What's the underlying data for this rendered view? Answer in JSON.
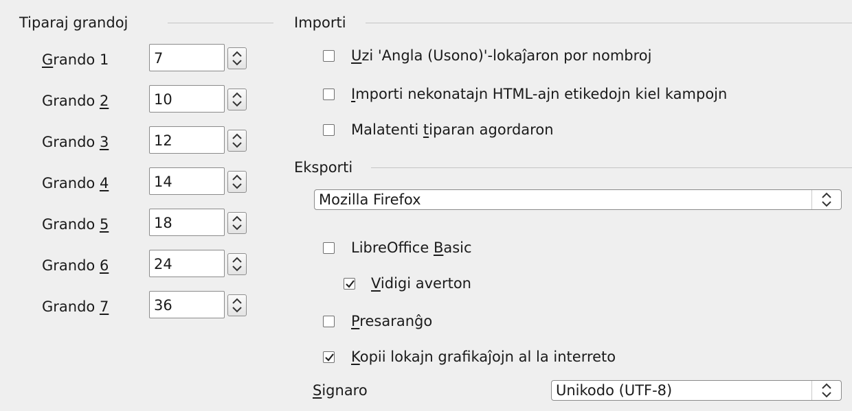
{
  "font_sizes": {
    "title": "Tiparaj grandoj",
    "rows": [
      {
        "label_pre": "",
        "label_ul": "G",
        "label_post": "rando 1",
        "value": "7"
      },
      {
        "label_pre": "Grando ",
        "label_ul": "2",
        "label_post": "",
        "value": "10"
      },
      {
        "label_pre": "Grando ",
        "label_ul": "3",
        "label_post": "",
        "value": "12"
      },
      {
        "label_pre": "Grando ",
        "label_ul": "4",
        "label_post": "",
        "value": "14"
      },
      {
        "label_pre": "Grando ",
        "label_ul": "5",
        "label_post": "",
        "value": "18"
      },
      {
        "label_pre": "Grando ",
        "label_ul": "6",
        "label_post": "",
        "value": "24"
      },
      {
        "label_pre": "Grando ",
        "label_ul": "7",
        "label_post": "",
        "value": "36"
      }
    ]
  },
  "import": {
    "title": "Importi",
    "options": [
      {
        "pre": "",
        "ul": "U",
        "post": "zi 'Angla (Usono)'-lokaĵaron por nombroj",
        "checked": false
      },
      {
        "pre": "",
        "ul": "I",
        "post": "mporti nekonatajn HTML-ajn etikedojn kiel kampojn",
        "checked": false
      },
      {
        "pre": "Malatenti ",
        "ul": "t",
        "post": "iparan agordaron",
        "checked": false
      }
    ]
  },
  "export": {
    "title": "Eksporti",
    "browser_selected": "Mozilla Firefox",
    "basic": {
      "pre": "LibreOffice ",
      "ul": "B",
      "post": "asic",
      "checked": false
    },
    "warning": {
      "pre": "",
      "ul": "V",
      "post": "idigi averton",
      "checked": true
    },
    "print_layout": {
      "pre": "",
      "ul": "P",
      "post": "resaranĝo",
      "checked": false
    },
    "copy_graphics": {
      "pre": "",
      "ul": "K",
      "post": "opii lokajn grafikaĵojn al la interreto",
      "checked": true
    },
    "charset_label": {
      "pre": "",
      "ul": "S",
      "post": "ignaro"
    },
    "charset_selected": "Unikodo (UTF-8)"
  }
}
